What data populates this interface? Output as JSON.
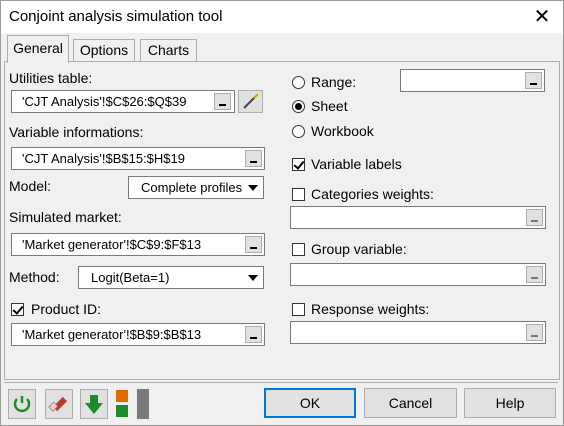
{
  "window": {
    "title": "Conjoint analysis simulation tool"
  },
  "tabs": [
    {
      "label": "General"
    },
    {
      "label": "Options"
    },
    {
      "label": "Charts"
    }
  ],
  "left": {
    "utilities_label": "Utilities table:",
    "utilities_value": "'CJT Analysis'!$C$26:$Q$39",
    "varinfo_label": "Variable informations:",
    "varinfo_value": "'CJT Analysis'!$B$15:$H$19",
    "model_label": "Model:",
    "model_value": "Complete profiles",
    "market_label": "Simulated market:",
    "market_value": "'Market generator'!$C$9:$F$13",
    "method_label": "Method:",
    "method_value": "Logit(Beta=1)",
    "productid_label": "Product ID:",
    "productid_checked": true,
    "productid_value": "'Market generator'!$B$9:$B$13"
  },
  "right": {
    "range_label": "Range:",
    "sheet_label": "Sheet",
    "workbook_label": "Workbook",
    "output_selected": "Sheet",
    "varlabels_label": "Variable labels",
    "varlabels_checked": true,
    "catweights_label": "Categories weights:",
    "catweights_checked": false,
    "groupvar_label": "Group variable:",
    "groupvar_checked": false,
    "respweights_label": "Response weights:",
    "respweights_checked": false
  },
  "footer": {
    "ok_label": "OK",
    "cancel_label": "Cancel",
    "help_label": "Help"
  },
  "icons": {
    "reset": "refresh-icon",
    "eraser": "eraser-icon",
    "down": "down-arrow-icon",
    "layout": "layout-icon"
  },
  "colors": {
    "accent": "#0078d7",
    "green_icon": "#1e8c2a",
    "orange_icon": "#e06b00",
    "eraser_red": "#c0392b"
  }
}
